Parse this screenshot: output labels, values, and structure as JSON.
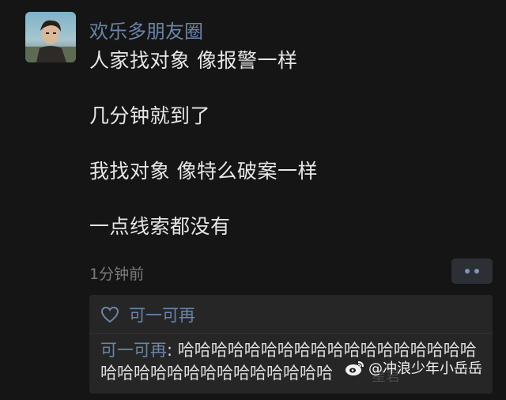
{
  "post": {
    "author": "欢乐多朋友圈",
    "lines": [
      "人家找对象 像报警一样",
      "几分钟就到了",
      "我找对象 像特么破案一样",
      "一点线索都没有"
    ],
    "timestamp": "1分钟前"
  },
  "icons": {
    "more": "more-dots-icon",
    "like": "heart-icon",
    "watermark": "weibo-icon"
  },
  "likes": {
    "names": "可一可再"
  },
  "comments": [
    {
      "author": "可一可再",
      "separator": ": ",
      "text": "哈哈哈哈哈哈哈哈哈哈哈哈哈哈哈哈哈哈哈哈哈哈哈哈哈哈哈哈哈哈哈哈"
    }
  ],
  "watermark": {
    "text": "@冲浪少年小岳岳",
    "faint_text": "星君"
  },
  "colors": {
    "background": "#151515",
    "name_blue": "#6b84a8",
    "text": "#e6e6e6",
    "muted": "#7a7a7a"
  }
}
